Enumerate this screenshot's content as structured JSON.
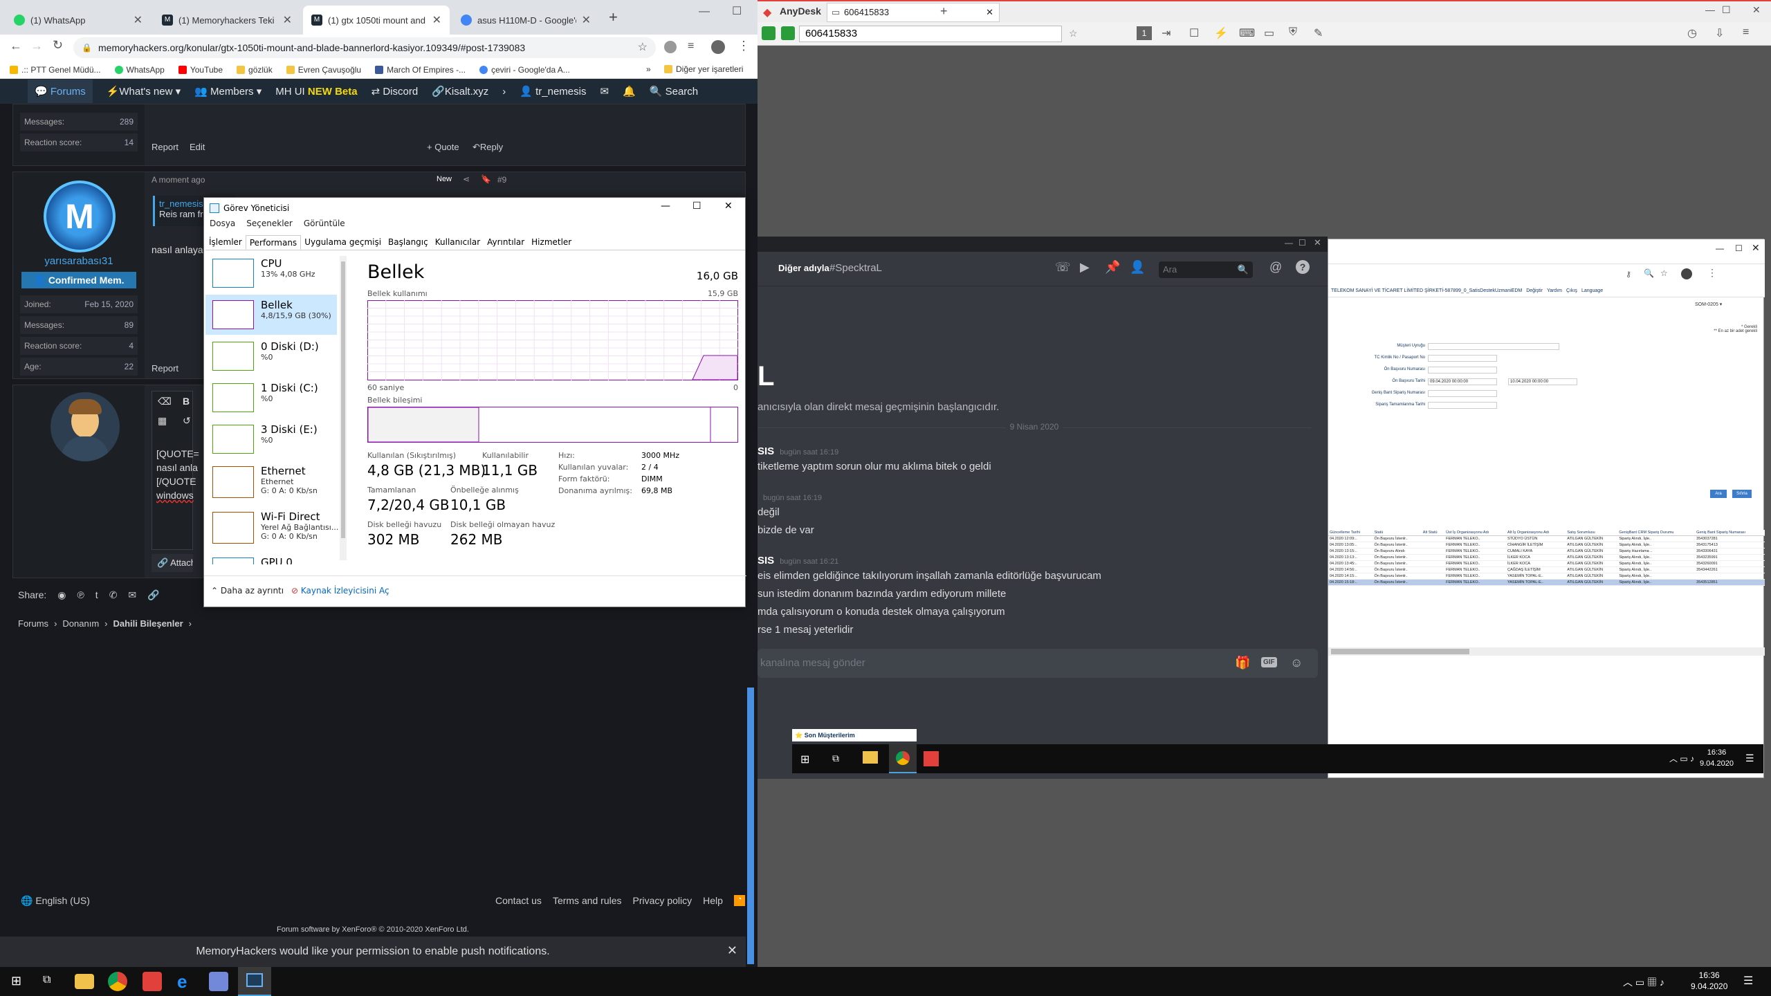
{
  "chrome": {
    "tabs": [
      {
        "title": "(1) WhatsApp",
        "color": "#25d366"
      },
      {
        "title": "(1) Memoryhackers Teki Hes",
        "color": "#1e2a36"
      },
      {
        "title": "(1) gtx 1050ti mount and bla",
        "color": "#1e2a36"
      },
      {
        "title": "asus H110M-D - Google'da",
        "color": "#4285f4"
      }
    ],
    "url": "memoryhackers.org/konular/gtx-1050ti-mount-and-blade-bannerlord-kasiyor.109349/#post-1739083",
    "bookmarks": [
      ".:: PTT Genel Müdü...",
      "WhatsApp",
      "YouTube",
      "gözlük",
      "Evren Çavuşoğlu",
      "March Of Empires -...",
      "çeviri - Google'da A..."
    ],
    "other_bookmarks": "Diğer yer işaretleri"
  },
  "site": {
    "nav": [
      "Forums",
      "What's new",
      "Members",
      "MH UI",
      "NEW Beta",
      "Discord",
      "Kisalt.xyz",
      "tr_nemesis",
      "Search"
    ],
    "post1": {
      "messages_label": "Messages:",
      "messages": "289",
      "reaction_label": "Reaction score:",
      "reaction": "14",
      "report": "Report",
      "edit": "Edit",
      "quote": "+ Quote",
      "reply": "Reply"
    },
    "post2": {
      "username": "yarısarabası31",
      "role": "Confirmed Mem.",
      "joined_label": "Joined:",
      "joined": "Feb 15, 2020",
      "messages_label": "Messages:",
      "messages": "89",
      "reaction_label": "Reaction score:",
      "reaction": "4",
      "age_label": "Age:",
      "age": "22",
      "time": "A moment ago",
      "badge": "New",
      "num": "#9",
      "quote_user": "tr_nemesis",
      "quote_text": "Reis ram fr",
      "body": "nasıl anlaya",
      "report": "Report"
    },
    "editor": {
      "lines": [
        "[QUOTE=",
        "nasıl anla",
        "[/QUOTE",
        "windows"
      ],
      "attach": "Attach fi"
    },
    "share_label": "Share:",
    "breadcrumb": [
      "Forums",
      "Donanım",
      "Dahili Bileşenler"
    ],
    "language": "English (US)",
    "footer_links": [
      "Contact us",
      "Terms and rules",
      "Privacy policy",
      "Help"
    ],
    "footer_credit": "Forum software by XenForo® © 2010-2020 XenForo Ltd.",
    "push": "MemoryHackers would like your permission to enable push notifications."
  },
  "taskmgr": {
    "title": "Görev Yöneticisi",
    "menu": [
      "Dosya",
      "Seçenekler",
      "Görüntüle"
    ],
    "tabs": [
      "İşlemler",
      "Performans",
      "Uygulama geçmişi",
      "Başlangıç",
      "Kullanıcılar",
      "Ayrıntılar",
      "Hizmetler"
    ],
    "items": [
      {
        "name": "CPU",
        "sub": "13%  4,08 GHz",
        "color": "#1183c7"
      },
      {
        "name": "Bellek",
        "sub": "4,8/15,9 GB (30%)",
        "color": "#8b12ae"
      },
      {
        "name": "0 Diski (D:)",
        "sub": "%0",
        "color": "#4da60c"
      },
      {
        "name": "1 Diski (C:)",
        "sub": "%0",
        "color": "#4da60c"
      },
      {
        "name": "3 Diski (E:)",
        "sub": "%0",
        "color": "#4da60c"
      },
      {
        "name": "Ethernet",
        "sub": "Ethernet",
        "sub2": "G: 0 A: 0 Kb/sn",
        "color": "#a74f01"
      },
      {
        "name": "Wi-Fi Direct",
        "sub": "Yerel Ağ Bağlantısı...",
        "sub2": "G: 0 A: 0 Kb/sn",
        "color": "#a74f01"
      },
      {
        "name": "GPU 0",
        "sub": "",
        "color": "#1183c7"
      }
    ],
    "heading": "Bellek",
    "total": "16,0 GB",
    "usage_label": "Bellek kullanımı",
    "usage_max": "15,9 GB",
    "axis_left": "60 saniye",
    "axis_right": "0",
    "composition_label": "Bellek bileşimi",
    "stats": {
      "in_use_label": "Kullanılan (Sıkıştırılmış)",
      "in_use": "4,8 GB (21,3 MB)",
      "available_label": "Kullanılabilir",
      "available": "11,1 GB",
      "committed_label": "Tamamlanan",
      "committed": "7,2/20,4 GB",
      "cached_label": "Önbelleğe alınmış",
      "cached": "10,1 GB",
      "paged_label": "Disk belleği havuzu",
      "paged": "302 MB",
      "nonpaged_label": "Disk belleği olmayan havuz",
      "nonpaged": "262 MB",
      "speed_label": "Hızı:",
      "speed": "3000 MHz",
      "slots_label": "Kullanılan yuvalar:",
      "slots": "2 / 4",
      "form_label": "Form faktörü:",
      "form": "DIMM",
      "reserved_label": "Donanıma ayrılmış:",
      "reserved": "69,8 MB"
    },
    "fewer": "Daha az ayrıntı",
    "resmon": "Kaynak İzleyicisini Aç"
  },
  "anydesk": {
    "title": "AnyDesk",
    "tab": "606415833",
    "id": "606415833"
  },
  "discord": {
    "friends": "Diğer adıyla",
    "channel": "#SpecktraL",
    "search_placeholder": "Ara",
    "start_text": "anıcısıyla olan direkt mesaj geçmişinin başlangıcıdır.",
    "big_letter": "L",
    "date": "9 Nisan 2020",
    "messages": [
      {
        "author": "SIS",
        "time": "bugün saat 16:19",
        "lines": [
          "tiketleme yaptım sorun olur mu aklıma bitek o geldi"
        ]
      },
      {
        "author": "",
        "time": "bugün saat 16:19",
        "lines": [
          "değil",
          "bizde de var"
        ]
      },
      {
        "author": "SIS",
        "time": "bugün saat 16:21",
        "lines": [
          "eis elimden geldiğince takılıyorum inşallah zamanla editörlüğe başvurucam",
          "sun istedim donanım bazında yardım ediyorum millete",
          "mda çalısıyorum o konuda destek olmaya çalışıyorum",
          "rse 1 mesaj yeterlidir"
        ]
      }
    ],
    "input_placeholder": "kanalına mesaj gönder"
  },
  "remote_browser": {
    "company": "TELEKOM SANAYİ VE TİCARET LİMİTED ŞİRKETİ-587899_0_SatisDestekUzmaniEDM",
    "links": [
      "Değiştir",
      "Yardım",
      "Çıkış",
      "Language"
    ],
    "select": "SOM-0205",
    "required_note": "* Gerekli",
    "required_note2": "** En az bir adet gerekli",
    "fields": [
      "Müşteri Uyruğu",
      "TC Kimlik No / Pasaport No",
      "Ön Başvuru Numarası",
      "Ön Başvuru Tarihi",
      "Geniş Bant Sipariş Numarası",
      "Sipariş Tamamlanma Tarihi"
    ],
    "date_from": "09.04.2020 00:00:00",
    "date_to": "10.04.2020 00:00:00",
    "search_btn": "Ara",
    "clear_btn": "Sıfırla",
    "columns": [
      "Güncelleme Tarihi",
      "Statü",
      "Alt Statü",
      "Üst İş Organizasyonu Adı",
      "Alt İş Organizasyonu Adı",
      "Satış Sorumlusu",
      "GenişBant CRM Sipariş Durumu",
      "Geniş Bant Sipariş Numarası"
    ],
    "rows": [
      [
        "04.2020 12:09:..",
        "Ön Başvuru İstenlr..",
        "",
        "FERMAN TELEKO..",
        "STÜDYO ÜSTÜN",
        "ATILGAN GÜLTEKİN",
        "Sipariş Alındı, İşle..",
        "3543037281"
      ],
      [
        "04.2020 13:05:..",
        "Ön Başvuru İstenlr..",
        "",
        "FERMAN TELEKO..",
        "CİHANGİR İLETİŞİM",
        "ATILGAN GÜLTEKİN",
        "Sipariş Alındı, İşle..",
        "3543175413"
      ],
      [
        "04.2020 13:15:..",
        "Ön Başvuru Alındı",
        "",
        "FERMAN TELEKO..",
        "CUMALI KAYA",
        "ATILGAN GÜLTEKİN",
        "Sipariş Hazırlama ..",
        "3543306431"
      ],
      [
        "04.2020 13:13:..",
        "Ön Başvuru İstenlr..",
        "",
        "FERMAN TELEKO..",
        "İLKER KOCA",
        "ATILGAN GÜLTEKİN",
        "Sipariş Alındı, İşle..",
        "3543235991"
      ],
      [
        "04.2020 13:45:..",
        "Ön Başvuru İstenlr..",
        "",
        "FERMAN TELEKO..",
        "İLKER KOCA",
        "ATILGAN GÜLTEKİN",
        "Sipariş Alındı, İşle..",
        "3543260091"
      ],
      [
        "04.2020 14:56:..",
        "Ön Başvuru İstenlr..",
        "",
        "FERMAN TELEKO..",
        "ÇAĞDAŞ İLETİŞİM",
        "ATILGAN GÜLTEKİN",
        "Sipariş Alındı, İşle..",
        "3543442261"
      ],
      [
        "04.2020 14:15:..",
        "Ön Başvuru İstenlr..",
        "",
        "FERMAN TELEKO..",
        "YASEMİN TOPAL-E..",
        "ATILGAN GÜLTEKİN",
        "Sipariş Alındı, İşle..",
        ""
      ],
      [
        "04.2020 15:18:..",
        "Ön Başvuru İstenlr..",
        "",
        "FERMAN TELEKO..",
        "YASEMİN TOPAL-E..",
        "ATILGAN GÜLTEKİN",
        "Sipariş Alındı, İşle..",
        "3543512851"
      ]
    ],
    "footer_item": "Son Müşterilerim"
  },
  "remote_taskbar": {
    "time": "16:36",
    "date": "9.04.2020"
  },
  "taskbar": {
    "time": "16:36",
    "date": "9.04.2020"
  }
}
